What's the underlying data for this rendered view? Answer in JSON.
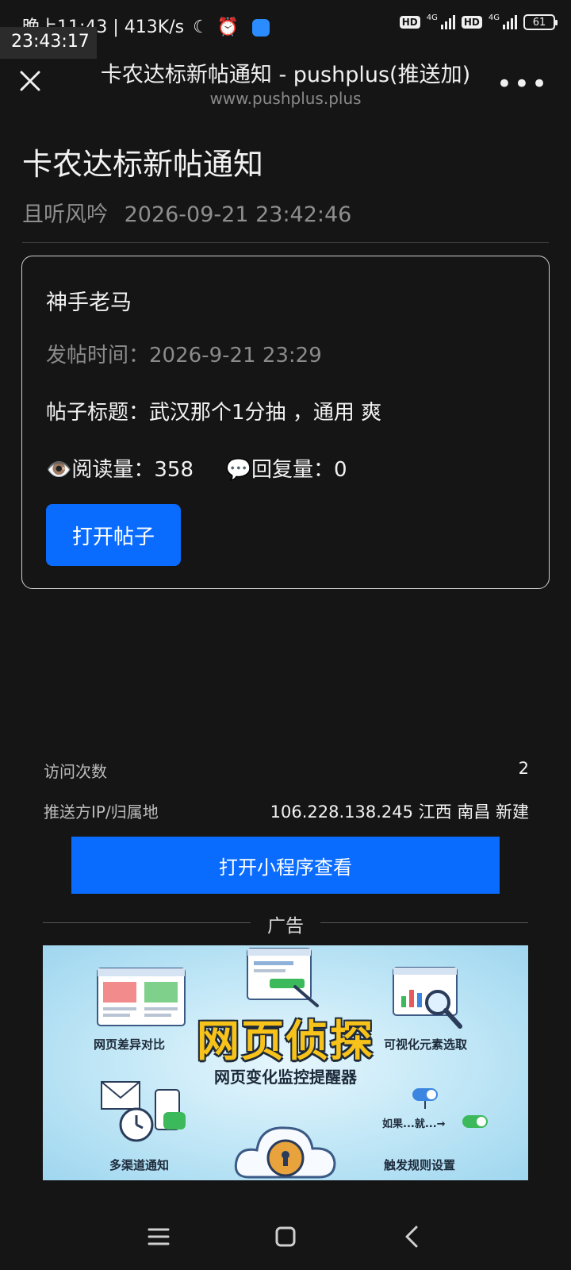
{
  "status_bar": {
    "left_text": "晚上11:43 | 413K/s",
    "moon": "☾",
    "alarm": "⏰",
    "clock_overlay": "23:43:17",
    "hd": "HD",
    "net": "4G",
    "battery": "61"
  },
  "header": {
    "title": "卡农达标新帖通知 - pushplus(推送加)",
    "url": "www.pushplus.plus",
    "more": "•••"
  },
  "article": {
    "title": "卡农达标新帖通知",
    "author": "且听风吟",
    "datetime": "2026-09-21 23:42:46"
  },
  "card": {
    "author": "神手老马",
    "post_time_label": "发帖时间：",
    "post_time": "2026-9-21 23:29",
    "subject_label": "帖子标题：",
    "subject": "武汉那个1分抽 ，通用 爽",
    "views_emoji": "👁️",
    "views_label": "阅读量：",
    "views": "358",
    "replies_emoji": "💬",
    "replies_label": "回复量：",
    "replies": "0",
    "open_button": "打开帖子"
  },
  "info": {
    "visits_label": "访问次数",
    "visits": "2",
    "ip_label": "推送方IP/归属地",
    "ip": "106.228.138.245 江西 南昌 新建"
  },
  "mini_program_button": "打开小程序查看",
  "ad": {
    "label": "广告",
    "main_title": "网页侦探",
    "sub_title": "网页变化监控提醒器",
    "features": [
      "网页差异对比",
      "可视化元素选取",
      "多渠道通知",
      "触发规则设置"
    ],
    "rule_text": "如果...就...→"
  },
  "colors": {
    "accent": "#0a6cff",
    "background": "#151515"
  }
}
